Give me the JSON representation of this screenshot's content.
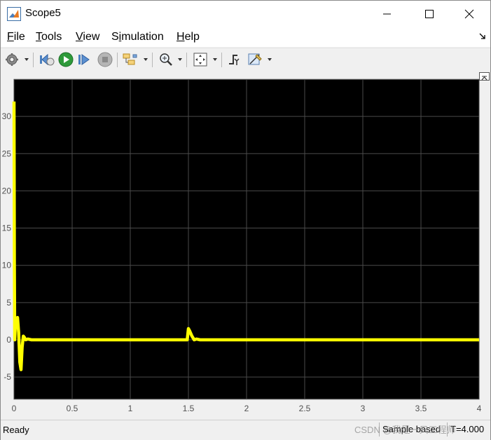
{
  "window": {
    "title": "Scope5"
  },
  "menu": {
    "items": [
      {
        "label": "File",
        "mnemonic": "F",
        "rest": "ile"
      },
      {
        "label": "Tools",
        "mnemonic": "T",
        "rest": "ools"
      },
      {
        "label": "View",
        "mnemonic": "V",
        "rest": "iew"
      },
      {
        "label": "Simulation",
        "pre": "S",
        "mnemonic": "i",
        "rest": "mulation"
      },
      {
        "label": "Help",
        "mnemonic": "H",
        "rest": "elp"
      }
    ]
  },
  "toolbar": {
    "buttons": [
      "settings-icon",
      "step-back-icon",
      "run-icon",
      "step-forward-icon",
      "stop-icon",
      "highlight-block-icon",
      "zoom-in-icon",
      "fit-to-view-icon",
      "triggers-icon",
      "cursor-measurements-icon"
    ]
  },
  "chart_data": {
    "type": "line",
    "title": "",
    "xlabel": "",
    "ylabel": "",
    "xlim": [
      0,
      4
    ],
    "ylim": [
      -8,
      35
    ],
    "xticks": [
      "0",
      "0.5",
      "1",
      "1.5",
      "2",
      "2.5",
      "3",
      "3.5",
      "4"
    ],
    "yticks": [
      "-5",
      "0",
      "5",
      "10",
      "15",
      "20",
      "25",
      "30"
    ],
    "grid": true,
    "background": "#000000",
    "line_color": "#ffff00",
    "series": [
      {
        "x": [
          0,
          0.003,
          0.006,
          0.01,
          0.02,
          0.03,
          0.04,
          0.05,
          0.06,
          0.07,
          0.08,
          0.09,
          0.1,
          0.12,
          0.15,
          0.2,
          0.5,
          1.0,
          1.49,
          1.5,
          1.51,
          1.53,
          1.55,
          1.57,
          1.6,
          2.0,
          2.5,
          3.0,
          3.5,
          4.0
        ],
        "y": [
          32,
          10,
          0,
          1.5,
          2.5,
          3,
          1,
          -3,
          -4,
          -1,
          0.5,
          0.3,
          0,
          0.1,
          0,
          0,
          0,
          0,
          0,
          1.5,
          1.2,
          0.5,
          0,
          0.1,
          0,
          0,
          0,
          0,
          0,
          0
        ]
      }
    ]
  },
  "status": {
    "left": "Ready",
    "mode": "Sample based",
    "time": "T=4.000"
  },
  "watermark": "CSDN @我是一只工程师"
}
